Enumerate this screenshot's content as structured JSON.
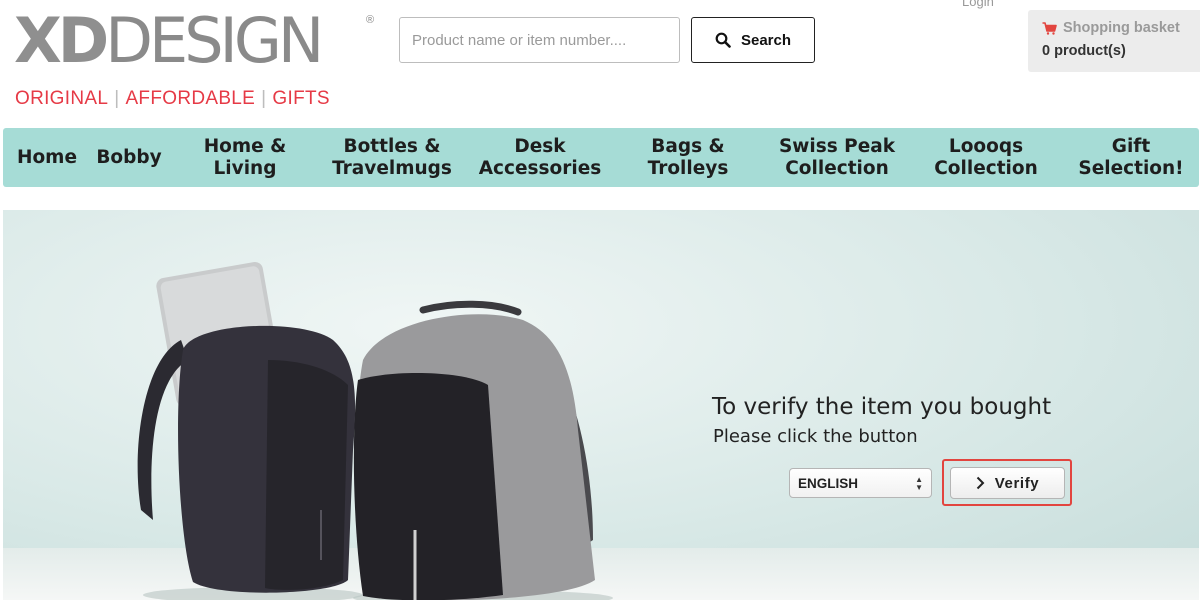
{
  "header": {
    "logo": {
      "word_bold": "XD",
      "word_light": "DESIGN",
      "registered": "®"
    },
    "tagline": [
      "ORIGINAL",
      "AFFORDABLE",
      "GIFTS"
    ],
    "tagline_separator": "|",
    "search": {
      "placeholder": "Product name or item number....",
      "button_label": "Search",
      "icon": "search-icon"
    },
    "login_label": "Login",
    "basket": {
      "label": "Shopping basket",
      "count_text": "0 product(s)",
      "icon": "cart-icon"
    }
  },
  "nav": {
    "items": [
      {
        "label": "Home"
      },
      {
        "label": "Bobby"
      },
      {
        "label": "Home &\nLiving"
      },
      {
        "label": "Bottles &\nTravelmugs"
      },
      {
        "label": "Desk\nAccessories"
      },
      {
        "label": "Bags &\nTrolleys"
      },
      {
        "label": "Swiss Peak\nCollection"
      },
      {
        "label": "Loooqs\nCollection"
      },
      {
        "label": "Gift\nSelection!"
      }
    ]
  },
  "hero": {
    "title": "To verify the item you bought",
    "subtitle": "Please click the button",
    "language_selected": "ENGLISH",
    "verify_label": "Verify"
  },
  "colors": {
    "nav_bg": "#a6dcd6",
    "tagline_red": "#e63a46",
    "highlight_red": "#e2453f",
    "basket_bg": "#ececec"
  }
}
